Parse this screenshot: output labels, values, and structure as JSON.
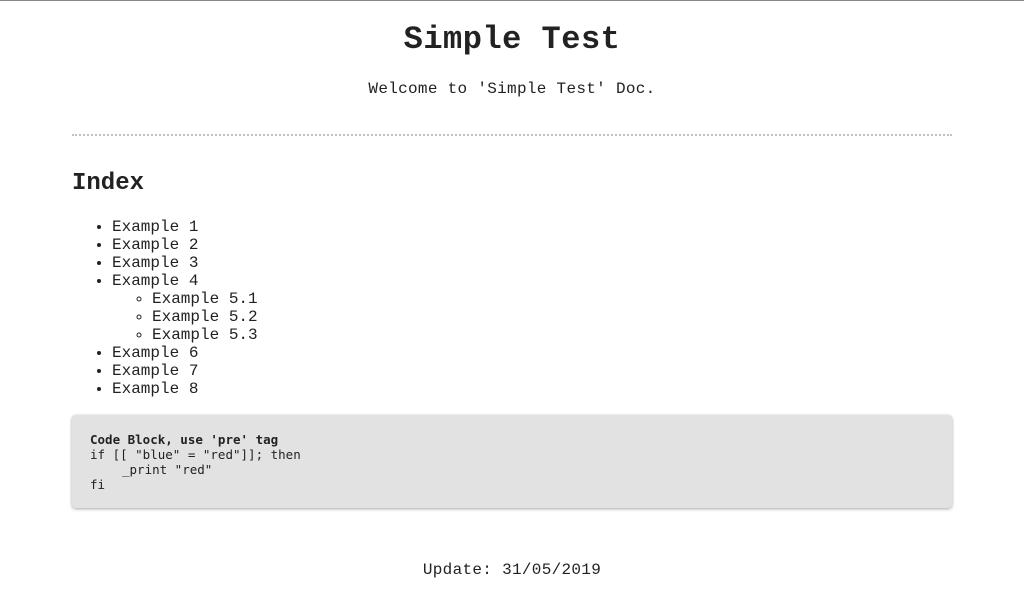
{
  "header": {
    "title": "Simple Test",
    "subtitle": "Welcome to 'Simple Test' Doc."
  },
  "index": {
    "heading": "Index",
    "items": [
      {
        "label": "Example 1"
      },
      {
        "label": "Example 2"
      },
      {
        "label": "Example 3"
      },
      {
        "label": "Example 4",
        "children": [
          {
            "label": "Example 5.1"
          },
          {
            "label": "Example 5.2"
          },
          {
            "label": "Example 5.3"
          }
        ]
      },
      {
        "label": "Example 6"
      },
      {
        "label": "Example 7"
      },
      {
        "label": "Example 8"
      }
    ]
  },
  "code_block": {
    "title": "Code Block, use 'pre' tag",
    "lines": [
      "if [[ \"blue\" = \"red\"]]; then",
      "_print \"red\"",
      "fi"
    ]
  },
  "footer": {
    "update": "Update: 31/05/2019"
  },
  "colors": {
    "text": "#222222",
    "code_background": "#e2e2e2",
    "divider": "#c2c2c2"
  }
}
